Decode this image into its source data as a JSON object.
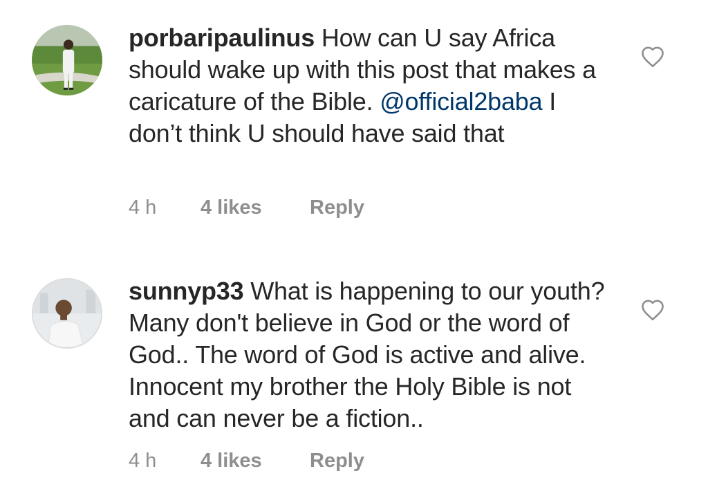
{
  "comments": [
    {
      "username": "porbaripaulinus",
      "text_before_mention": " How can U say Africa should wake up with this post that makes a caricature of the Bible. ",
      "mention": "@official2baba",
      "text_after_mention": " I don’t think U should have said that",
      "time": "4 h",
      "likes": "4 likes",
      "reply_label": "Reply",
      "avatar_icon": "user-avatar",
      "like_icon": "heart-outline-icon"
    },
    {
      "username": "sunnyp33",
      "text": " What is happening to our youth? Many don't believe in God or the word of God.. The word of God is active and alive.  Innocent my brother the Holy Bible is not and can never be a fiction..",
      "time": "4 h",
      "likes": "4 likes",
      "reply_label": "Reply",
      "avatar_icon": "user-avatar",
      "like_icon": "heart-outline-icon"
    }
  ],
  "colors": {
    "text": "#262626",
    "meta": "#8e8e8e",
    "mention": "#00376b",
    "icon": "#8e8e8e"
  }
}
